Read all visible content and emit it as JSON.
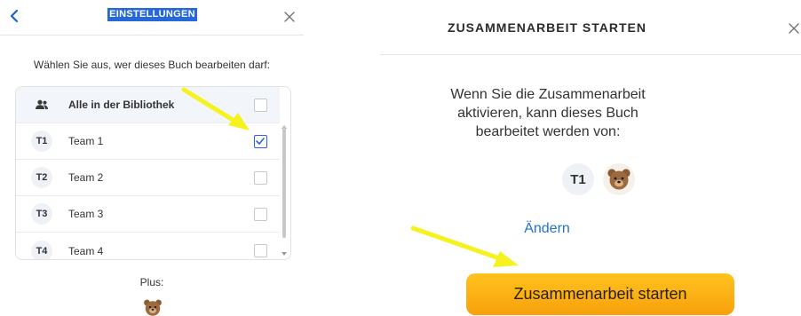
{
  "left_panel": {
    "back_icon": "chevron-left-icon",
    "title": "EINSTELLUNGEN",
    "close_icon": "close-icon",
    "prompt": "Wählen Sie aus, wer dieses Buch bearbeiten darf:",
    "members": [
      {
        "icon": "group-icon",
        "label": "Alle in der Bibliothek",
        "checked": false
      },
      {
        "initials": "T1",
        "label": "Team 1",
        "checked": true
      },
      {
        "initials": "T2",
        "label": "Team 2",
        "checked": false
      },
      {
        "initials": "T3",
        "label": "Team 3",
        "checked": false
      },
      {
        "initials": "T4",
        "label": "Team 4",
        "checked": false
      }
    ],
    "plus_label": "Plus:",
    "plus_avatar": "bear-avatar-icon"
  },
  "right_panel": {
    "title": "ZUSAMMENARBEIT STARTEN",
    "close_icon": "close-icon",
    "description": "Wenn Sie die Zusammenarbeit aktivieren, kann dieses Buch bearbeitet werden von:",
    "collaborators": [
      {
        "initials": "T1"
      },
      {
        "icon": "bear-avatar-icon"
      }
    ],
    "change_link": "Ändern",
    "start_button": "Zusammenarbeit starten"
  },
  "colors": {
    "accent_blue": "#2667d9",
    "link_blue": "#2572c9",
    "button_orange": "#f8a10c",
    "annotation_arrow": "#f5f21f"
  }
}
